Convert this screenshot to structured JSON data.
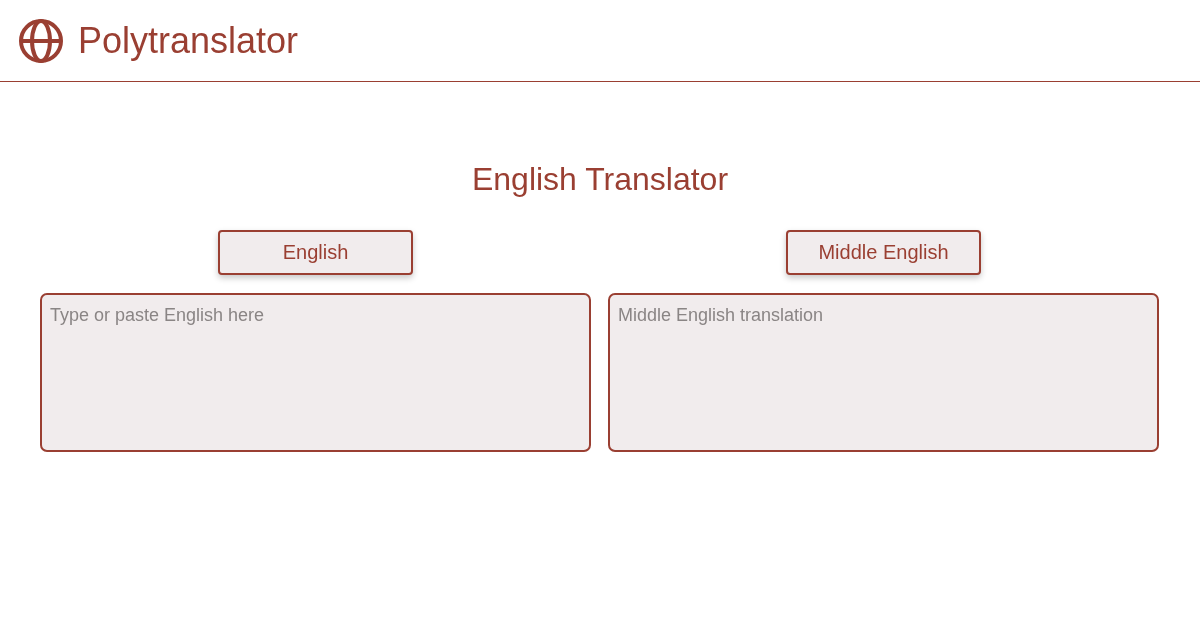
{
  "header": {
    "title": "Polytranslator"
  },
  "page_title": "English Translator",
  "source": {
    "language_button": "English",
    "placeholder": "Type or paste English here"
  },
  "target": {
    "language_button": "Middle English",
    "placeholder": "Middle English translation"
  }
}
